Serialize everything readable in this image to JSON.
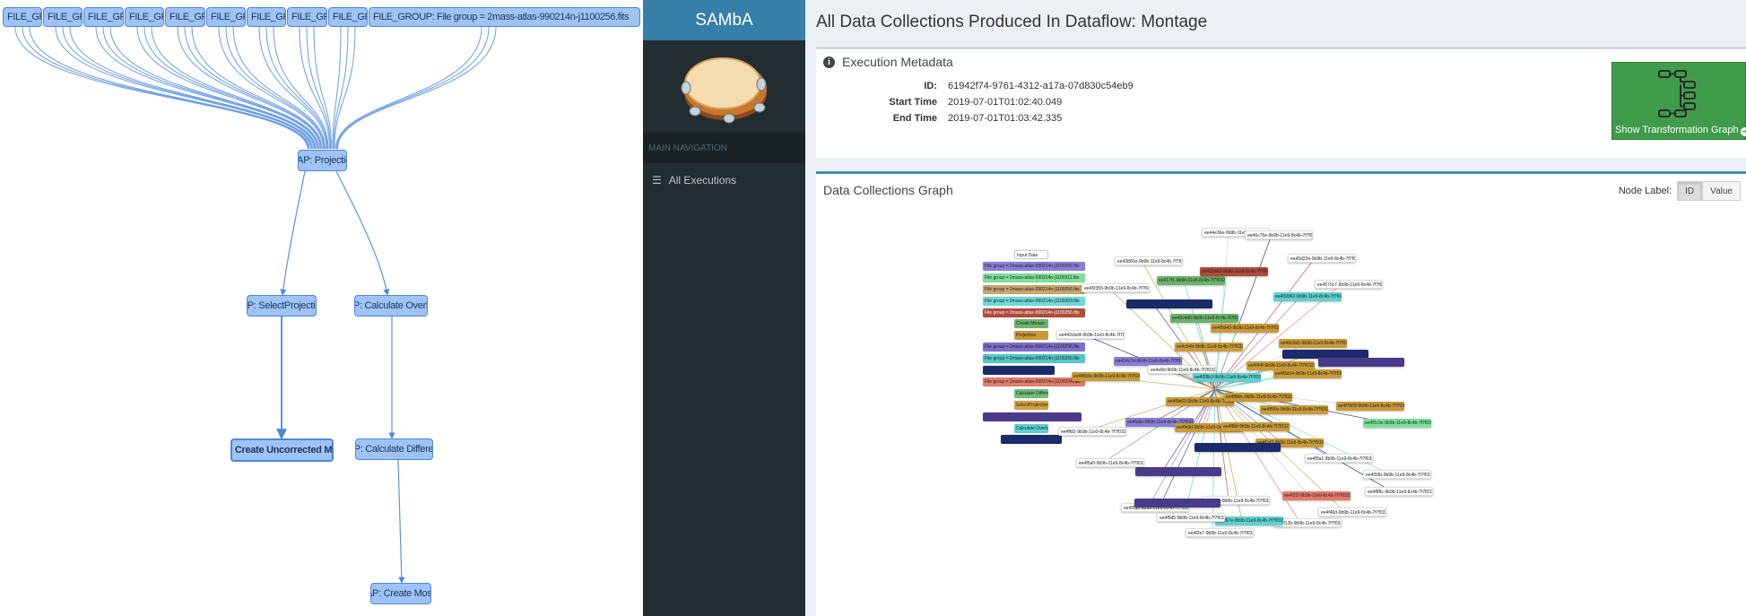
{
  "left_graph": {
    "top_nodes": [
      "FILE_GROUP: Fil",
      "FILE_GROUP: Fil",
      "FILE_GROUP: Fil",
      "FILE_GROUP: Fil",
      "FILE_GROUP: Fil",
      "FILE_GROUP: Fil",
      "FILE_GROUP: Fil",
      "FILE_GROUP: Fil",
      "FILE_GROUP: Fil",
      "FILE_GROUP: File group = 2mass-atlas-990214n-j1100256.fits"
    ],
    "projection": "MAP: Projection",
    "select_projections": "MAP: SelectProjections",
    "calculate_overlaps": "MAP: Calculate Overlaps",
    "create_uncorrected_mosaic": "MAP: Create Uncorrected Mosaic",
    "calculate_difference": "MAP: Calculate Difference",
    "create_mosaic": "MAP: Create Mosaic"
  },
  "sidebar": {
    "brand": "SAMbA",
    "nav_header": "MAIN NAVIGATION",
    "nav_item": "All Executions",
    "nav_icon": "list-icon"
  },
  "main": {
    "title": "All Data Collections Produced In Dataflow: Montage",
    "metadata": {
      "header": "Execution Metadata",
      "rows": [
        {
          "key": "ID:",
          "value": "61942f74-9761-4312-a17a-07d830c54eb9"
        },
        {
          "key": "Start Time",
          "value": "2019-07-01T01:02:40.049"
        },
        {
          "key": "End Time",
          "value": "2019-07-01T01:03:42.335"
        }
      ],
      "show_graph_label": "Show Transformation Graph"
    },
    "dc_graph": {
      "title": "Data Collections Graph",
      "node_label": "Node Label:",
      "toggle_id": "ID",
      "toggle_value": "Value",
      "legend": [
        {
          "text": "Input Data",
          "color": "#ffffff"
        },
        {
          "text": "File group = 2mass-atlas-990214n-j1100256.fits",
          "color": "#8a7fd6"
        },
        {
          "text": "File group = 2mass-atlas-990214n-j1100311.fits",
          "color": "#7be09a"
        },
        {
          "text": "File group = 2mass-atlas-990214n-j1100256.fits",
          "color": "#c7a56b"
        },
        {
          "text": "File group = 2mass-atlas-990214n-j1100303.fits",
          "color": "#6fd9d9"
        },
        {
          "text": "File group = 2mass-atlas-990214n-j1100256.fits",
          "color": "#b04a3a"
        },
        {
          "text": "Create Mosaic",
          "color": "#6ab36b"
        },
        {
          "text": "Projection",
          "color": "#c99a36"
        },
        {
          "text": "File group = 2mass-atlas-990214n-j1100256.fits",
          "color": "#7d6fcc"
        },
        {
          "text": "File group = 2mass-atlas-990214n-j1100256.fits",
          "color": "#52c9c9"
        },
        {
          "text": "",
          "color": "#1b2a6b"
        },
        {
          "text": "File group = 2mass-atlas-990214n-j1100334.fits",
          "color": "#e37b6b"
        },
        {
          "text": "Calculate Difference",
          "color": "#6fbf7a"
        },
        {
          "text": "SelectProjections",
          "color": "#d1a03f"
        },
        {
          "text": "",
          "color": "#4a3a8a"
        },
        {
          "text": "Calculate Overlaps",
          "color": "#5ed1d1"
        },
        {
          "text": "",
          "color": "#1b2a6b"
        }
      ],
      "node_labels": [
        "ee44e36e-9b9b-11e9-8c4b-7f7f0327184",
        "ee46c76e-9b9b-11e9-8c4b-7f7f0327184",
        "ee43860e-9b9b-11e9-8c4b-7f7f0327184",
        "ee45d23e-9b9b-11e9-8c4b-7f7f0327184",
        "ee4570c7-9b9b-11e9-8c4b-7f7f0327184",
        "ee45f355-9b9b-11e9-8c4b-7f7f0327184",
        "ee459962-9b9b-11e9-8c4b-7f7f0327184",
        "ee417f1-9b9b-11e9-8c4b-7f7f0327184",
        "ee41bd42-9b9b-11e9-8c4b-7f7f0327184",
        "ee4d93d4-9b9b-11e9-8c4b-7f7f0327184",
        "ee42c4d6-9b9b-11e9-8c4b-7f7f0327184",
        "ee4f5d40-9b9b-11e9-8c4b-7f7f0327184",
        "ee46c9a5-9b9b-11e9-8c4b-7f7f0327184",
        "ee442cbd4-9b9b-11e9-8c4b-7f7f0327184",
        "ee424c7d-9b9b-11e9-8c4b-7f7f0327184",
        "ee4c64b-9b9b-11e9-8c4b-7f7f0327184",
        "ee4e8d-9b9b-11e9-8c4b-7f7f0327184",
        "ee4f80de-9b9b-11e9-8c4b-7f7f0327184",
        "ee4f44f-9b9b-11e9-8c4b-7f7f0327184",
        "ee4f28b3-9b9b-11e9-8c4b-7f7f0327184",
        "ee4f3e54-9b9b-11e9-8c4b-7f7f0327184",
        "ee4f9e03-9b9b-11e9-8c4b-7f7f0327184",
        "ee4f8bfc-9b9b-11e9-8c4b-7f7f0327184",
        "ee4f5f0c-9b9b-11e9-8c4b-7f7f0327184",
        "ee4f7b09-9b9b-11e9-8c4b-7f7f0327184",
        "ee4f2c3e-9b9b-11e9-8c4b-7f7f0327184",
        "ee4ffd1-9b9b-11e9-8c4b-7f7f0327184",
        "ee4fa8e-9b9b-11e9-8c4b-7f7f0327184",
        "ee4fe9d-9b9b-11e9-8c4b-7f7f0327184",
        "ee4f6bf-9b9b-11e9-8c4b-7f7f0327184",
        "ee4f1d2-9b9b-11e9-8c4b-7f7f0327184",
        "ee4f0a1-9b9b-11e9-8c4b-7f7f0327184",
        "ee4f9c4-9b9b-11e9-8c4b-7f7f0327184",
        "ee4f77e-9b9b-11e9-8c4b-7f7f0327184",
        "ee4f5a0-9b9b-11e9-8c4b-7f7f0327184",
        "ee4f33b-9b9b-11e9-8c4b-7f7f0327184",
        "ee4f21f-9b9b-11e9-8c4b-7f7f0327184",
        "ee4f88c-9b9b-11e9-8c4b-7f7f0327184",
        "ee4f46d-9b9b-11e9-8c4b-7f7f0327184",
        "ee4f90a-9b9b-11e9-8c4b-7f7f0327184",
        "ee4f12b-9b9b-11e9-8c4b-7f7f0327184",
        "ee4f67e-9b9b-11e9-8c4b-7f7f0327184",
        "ee4f3a9-9b9b-11e9-8c4b-7f7f0327184",
        "ee4f5d5-9b9b-11e9-8c4b-7f7f0327184",
        "ee4f2e7-9b9b-11e9-8c4b-7f7f0327184",
        "ee4f81c-9b9b-11e9-8c4b-7f7f0327184",
        "ee4f0f3-9b9b-11e9-8c4b-7f7f0327184",
        "ee4f6a2-9b9b-11e9-8c4b-7f7f0327184"
      ]
    }
  }
}
